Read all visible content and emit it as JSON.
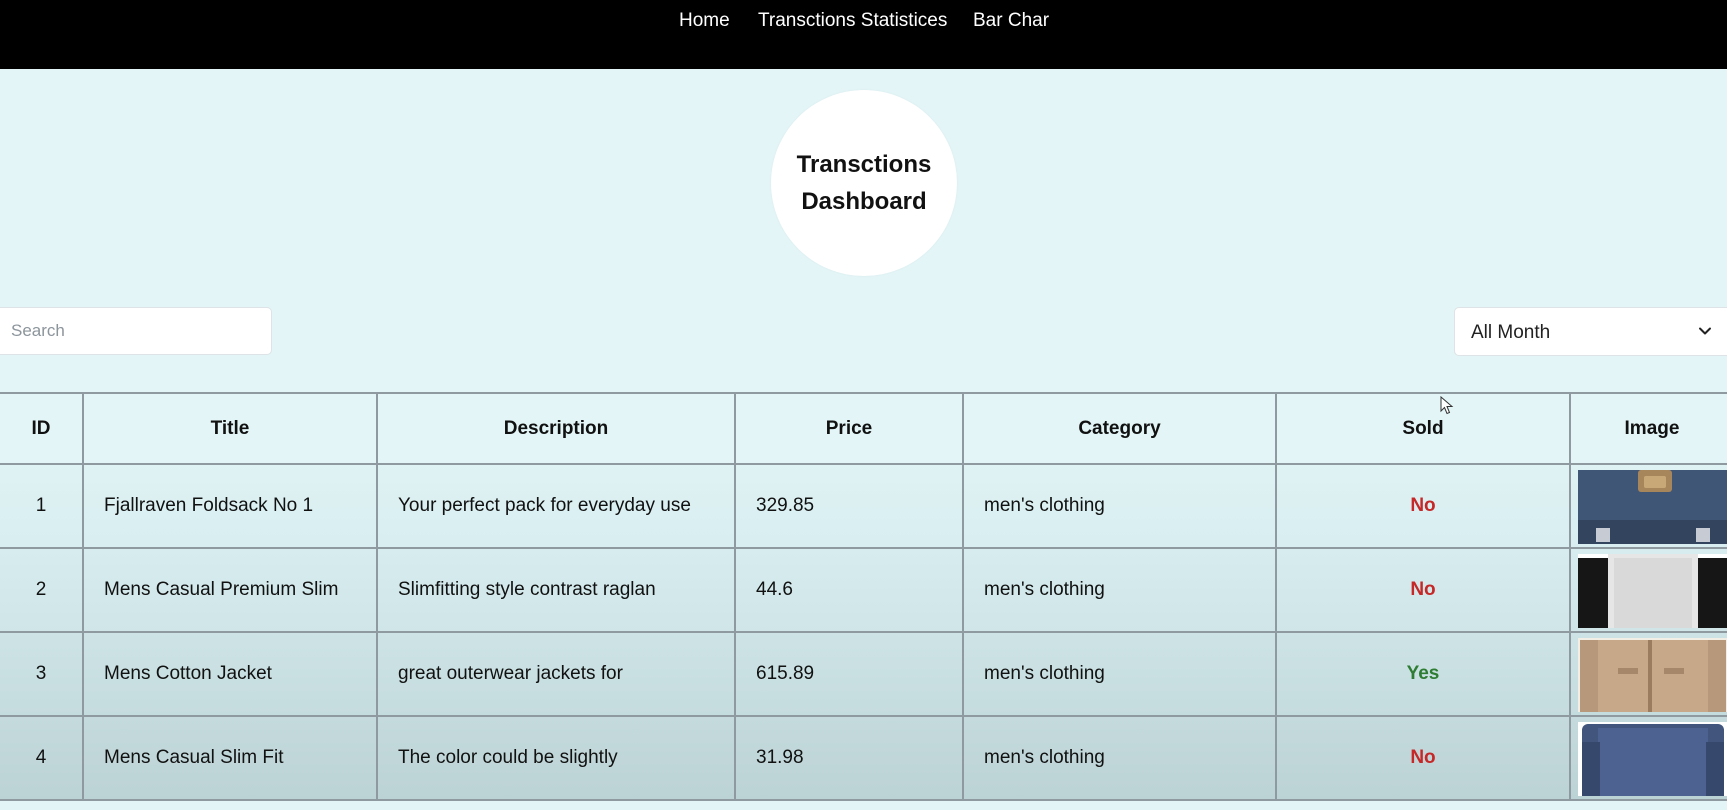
{
  "nav": {
    "items": [
      {
        "label": "Home"
      },
      {
        "label": "Transctions Statistices"
      },
      {
        "label": "Bar Char"
      }
    ]
  },
  "hero": {
    "title_line1": "Transctions",
    "title_line2": "Dashboard"
  },
  "search": {
    "placeholder": "Search",
    "value": ""
  },
  "month_filter": {
    "selected": "All Month"
  },
  "table": {
    "columns": [
      "ID",
      "Title",
      "Description",
      "Price",
      "Category",
      "Sold",
      "Image"
    ],
    "rows": [
      {
        "id": "1",
        "title": "Fjallraven Foldsack No 1",
        "description": "Your perfect pack for everyday use",
        "price": "329.85",
        "category": "men's clothing",
        "sold": "No",
        "image_icon": "backpack-thumbnail"
      },
      {
        "id": "2",
        "title": "Mens Casual Premium Slim",
        "description": "Slimfitting style contrast raglan",
        "price": "44.6",
        "category": "men's clothing",
        "sold": "No",
        "image_icon": "tshirt-thumbnail"
      },
      {
        "id": "3",
        "title": "Mens Cotton Jacket",
        "description": "great outerwear jackets for",
        "price": "615.89",
        "category": "men's clothing",
        "sold": "Yes",
        "image_icon": "jacket-thumbnail"
      },
      {
        "id": "4",
        "title": "Mens Casual Slim Fit",
        "description": "The color could be slightly",
        "price": "31.98",
        "category": "men's clothing",
        "sold": "No",
        "image_icon": "longsleeve-thumbnail"
      }
    ]
  },
  "colors": {
    "nav_background": "#000000",
    "page_background": "#e3f5f7",
    "sold_no": "#c62828",
    "sold_yes": "#2e7d32"
  }
}
